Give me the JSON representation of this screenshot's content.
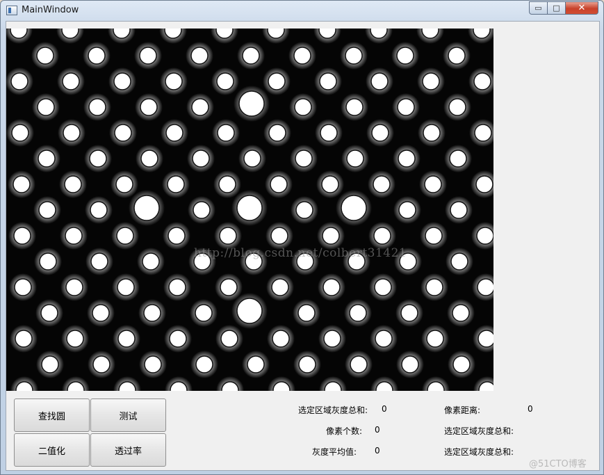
{
  "window": {
    "title": "MainWindow"
  },
  "controls": {
    "minimize": "▭",
    "maximize": "□",
    "close": "✕"
  },
  "image": {
    "watermark": "http://blog.csdn.net/colbert31421"
  },
  "buttons": {
    "find_circle": "查找圆",
    "test": "测试",
    "binarize": "二值化",
    "transmittance": "透过率"
  },
  "stats": {
    "region_gray_sum_label": "选定区域灰度总和:",
    "region_gray_sum_value": "0",
    "pixel_count_label": "像素个数:",
    "pixel_count_value": "0",
    "gray_avg_label": "灰度平均值:",
    "gray_avg_value": "0",
    "pixel_distance_label": "像素距离:",
    "pixel_distance_value": "0",
    "region_gray_sum_label_2": "选定区域灰度总和:",
    "region_gray_sum_label_3": "选定区域灰度总和:"
  },
  "branding": {
    "text": "@51CTO博客"
  }
}
